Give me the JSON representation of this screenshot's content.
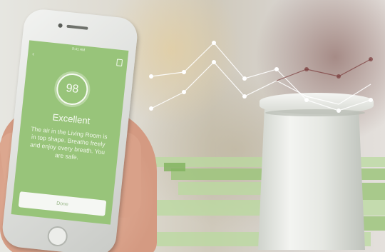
{
  "phone_screen": {
    "status_time": "9:41 AM",
    "score": "98",
    "status_title": "Excellent",
    "message": "The air in the Living Room is in top shape. Breathe freely and enjoy every breath. You are safe.",
    "done_label": "Done",
    "icons": [
      "back-arrow-icon",
      "share-icon"
    ]
  },
  "colors": {
    "screen_green": "#98c47a",
    "overlay_green": "#9dc67d",
    "line_white": "#ffffff",
    "line_dark_red": "#7a3b3b"
  }
}
